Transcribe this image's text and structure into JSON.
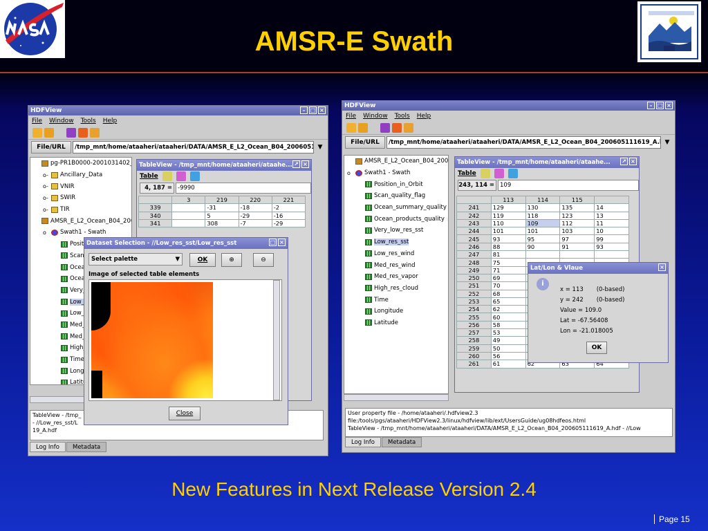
{
  "slide": {
    "title": "AMSR-E Swath",
    "subtitle": "New Features in Next Release Version 2.4",
    "page": "Page 15"
  },
  "left": {
    "window_title": "HDFView",
    "menu": [
      "File",
      "Window",
      "Tools",
      "Help"
    ],
    "file_label": "File/URL",
    "file_url": "/tmp_mnt/home/ataaheri/ataaheri/DATA/AMSR_E_L2_Ocean_B04_200605111619_A.hdf",
    "tree": [
      {
        "label": "pg-PR1B0000-2001031402_045",
        "kind": "file",
        "indent": 0,
        "exp": ""
      },
      {
        "label": "Ancillary_Data",
        "kind": "folder",
        "indent": 1,
        "exp": "o-"
      },
      {
        "label": "VNIR",
        "kind": "folder",
        "indent": 1,
        "exp": "o-"
      },
      {
        "label": "SWIR",
        "kind": "folder",
        "indent": 1,
        "exp": "o-"
      },
      {
        "label": "TIR",
        "kind": "folder",
        "indent": 1,
        "exp": "o-"
      },
      {
        "label": "AMSR_E_L2_Ocean_B04_2006",
        "kind": "file",
        "indent": 0,
        "exp": ""
      },
      {
        "label": "Swath1 - Swath",
        "kind": "swath",
        "indent": 1,
        "exp": "o"
      },
      {
        "label": "Position",
        "kind": "grid",
        "indent": 2,
        "exp": ""
      },
      {
        "label": "Scan_qu",
        "kind": "grid",
        "indent": 2,
        "exp": ""
      },
      {
        "label": "Ocean_",
        "kind": "grid",
        "indent": 2,
        "exp": ""
      },
      {
        "label": "Ocean_",
        "kind": "grid",
        "indent": 2,
        "exp": ""
      },
      {
        "label": "Very_lov",
        "kind": "grid",
        "indent": 2,
        "exp": ""
      },
      {
        "label": "Low_res",
        "kind": "grid",
        "indent": 2,
        "exp": "",
        "sel": true
      },
      {
        "label": "Low_res",
        "kind": "grid",
        "indent": 2,
        "exp": ""
      },
      {
        "label": "Med_res",
        "kind": "grid",
        "indent": 2,
        "exp": ""
      },
      {
        "label": "Med_res",
        "kind": "grid",
        "indent": 2,
        "exp": ""
      },
      {
        "label": "High_res",
        "kind": "grid",
        "indent": 2,
        "exp": ""
      },
      {
        "label": "Time",
        "kind": "grid",
        "indent": 2,
        "exp": ""
      },
      {
        "label": "Longitu",
        "kind": "grid",
        "indent": 2,
        "exp": ""
      },
      {
        "label": "Latitude",
        "kind": "grid",
        "indent": 2,
        "exp": ""
      }
    ],
    "log": [
      "TableView - /tmp_",
      "- //Low_res_sst/L",
      "19_A.hdf"
    ],
    "tabs": [
      "Log Info",
      "Metadata"
    ],
    "tableview": {
      "title": "TableView - /tmp_mnt/home/ataaheri/ataahe...",
      "table_label": "Table",
      "cell_ref": "4, 187 =",
      "cell_value": "-9990",
      "columns": [
        "3",
        "219",
        "220",
        "221"
      ],
      "rows": [
        [
          "339",
          "",
          "-31",
          "-18",
          "-2"
        ],
        [
          "340",
          "",
          "5",
          "-29",
          "-16"
        ],
        [
          "341",
          "",
          "308",
          "-7",
          "-29"
        ]
      ]
    },
    "dialog": {
      "title": "Dataset Selection - //Low_res_sst/Low_res_sst",
      "palette_label": "Select palette",
      "ok": "OK",
      "image_caption": "Image of selected table elements",
      "close": "Close"
    }
  },
  "right": {
    "window_title": "HDFView",
    "menu": [
      "File",
      "Window",
      "Tools",
      "Help"
    ],
    "file_label": "File/URL",
    "file_url": "/tmp_mnt/home/ataaheri/ataaheri/DATA/AMSR_E_L2_Ocean_B04_200605111619_A.hdf",
    "tree": [
      {
        "label": "AMSR_E_L2_Ocean_B04_2006",
        "kind": "file",
        "indent": 0,
        "exp": ""
      },
      {
        "label": "Swath1 - Swath",
        "kind": "swath",
        "indent": 0,
        "exp": "o"
      },
      {
        "label": "Position_in_Orbit",
        "kind": "grid",
        "indent": 1,
        "exp": ""
      },
      {
        "label": "Scan_quality_flag",
        "kind": "grid",
        "indent": 1,
        "exp": ""
      },
      {
        "label": "Ocean_summary_quality",
        "kind": "grid",
        "indent": 1,
        "exp": ""
      },
      {
        "label": "Ocean_products_quality",
        "kind": "grid",
        "indent": 1,
        "exp": ""
      },
      {
        "label": "Very_low_res_sst",
        "kind": "grid",
        "indent": 1,
        "exp": ""
      },
      {
        "label": "Low_res_sst",
        "kind": "grid",
        "indent": 1,
        "exp": "",
        "sel": true
      },
      {
        "label": "Low_res_wind",
        "kind": "grid",
        "indent": 1,
        "exp": ""
      },
      {
        "label": "Med_res_wind",
        "kind": "grid",
        "indent": 1,
        "exp": ""
      },
      {
        "label": "Med_res_vapor",
        "kind": "grid",
        "indent": 1,
        "exp": ""
      },
      {
        "label": "High_res_cloud",
        "kind": "grid",
        "indent": 1,
        "exp": ""
      },
      {
        "label": "Time",
        "kind": "grid",
        "indent": 1,
        "exp": ""
      },
      {
        "label": "Longitude",
        "kind": "grid",
        "indent": 1,
        "exp": ""
      },
      {
        "label": "Latitude",
        "kind": "grid",
        "indent": 1,
        "exp": ""
      }
    ],
    "log": [
      "User property file - /home/ataaheri/.hdfview2.3",
      "file:/tools/pgs/ataaheri/HDFView2.3/linux/hdfview/lib/ext/UsersGuide/ug08hdfeos.html",
      "TableView - /tmp_mnt/home/ataaheri/ataaheri/DATA/AMSR_E_L2_Ocean_B04_200605111619_A.hdf - //Low"
    ],
    "tabs": [
      "Log Info",
      "Metadata"
    ],
    "tableview": {
      "title": "TableView - /tmp_mnt/home/ataaheri/ataahe...",
      "table_label": "Table",
      "cell_ref": "243, 114 =",
      "cell_value": "109",
      "columns": [
        "113",
        "114",
        "115",
        ""
      ],
      "rows": [
        [
          "241",
          "129",
          "130",
          "135",
          "14"
        ],
        [
          "242",
          "119",
          "118",
          "123",
          "13"
        ],
        [
          "243",
          "110",
          "109",
          "112",
          "11"
        ],
        [
          "244",
          "101",
          "101",
          "103",
          "10"
        ],
        [
          "245",
          "93",
          "95",
          "97",
          "99"
        ],
        [
          "246",
          "88",
          "90",
          "91",
          "93"
        ],
        [
          "247",
          "81",
          "",
          "",
          ""
        ],
        [
          "248",
          "75",
          "",
          "",
          ""
        ],
        [
          "249",
          "71",
          "",
          "",
          ""
        ],
        [
          "250",
          "69",
          "",
          "",
          ""
        ],
        [
          "251",
          "70",
          "",
          "",
          ""
        ],
        [
          "252",
          "68",
          "",
          "",
          ""
        ],
        [
          "253",
          "65",
          "",
          "",
          ""
        ],
        [
          "254",
          "62",
          "",
          "",
          ""
        ],
        [
          "255",
          "60",
          "",
          "",
          ""
        ],
        [
          "256",
          "58",
          "",
          "",
          ""
        ],
        [
          "257",
          "53",
          "",
          "",
          ""
        ],
        [
          "258",
          "49",
          "",
          "",
          ""
        ],
        [
          "259",
          "50",
          "56",
          "66",
          "70"
        ],
        [
          "260",
          "56",
          "59",
          "66",
          "68"
        ],
        [
          "261",
          "61",
          "62",
          "63",
          "64"
        ]
      ]
    },
    "latlon": {
      "title": "Lat/Lon & Vlaue",
      "x": "x = 113",
      "x_note": "(0-based)",
      "y": "y = 242",
      "y_note": "(0-based)",
      "value": "Value = 109.0",
      "lat": "Lat = -67.56408",
      "lon": "Lon = -21.018005",
      "ok": "OK"
    }
  }
}
